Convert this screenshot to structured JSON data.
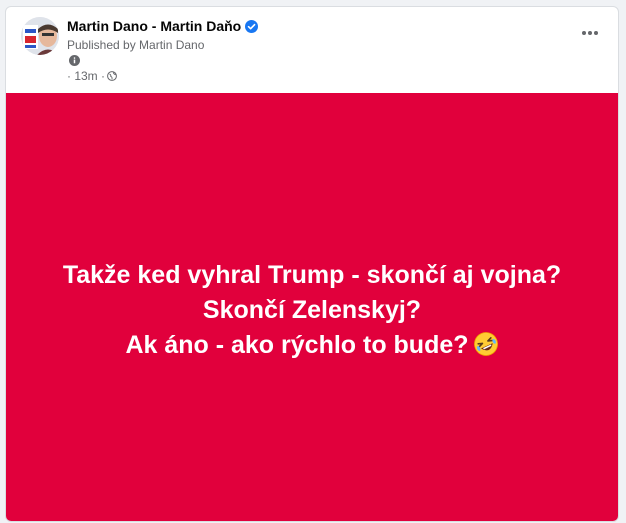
{
  "post": {
    "page_name": "Martin Dano - Martin Daňo",
    "published_prefix": "Published by ",
    "published_author": "Martin Dano",
    "time": "· 13m ·",
    "text_lines": [
      "Takže ked vyhral Trump - skončí aj vojna?",
      "Skončí Zelenskyj?",
      "Ak áno - ako rýchlo to bude?"
    ],
    "emoji": "rolling-on-the-floor-laughing",
    "background_color": "#e1003c"
  },
  "icons": {
    "verified": "verified-badge-icon",
    "info": "info-icon",
    "privacy": "globe-icon",
    "more": "more-options-icon"
  }
}
